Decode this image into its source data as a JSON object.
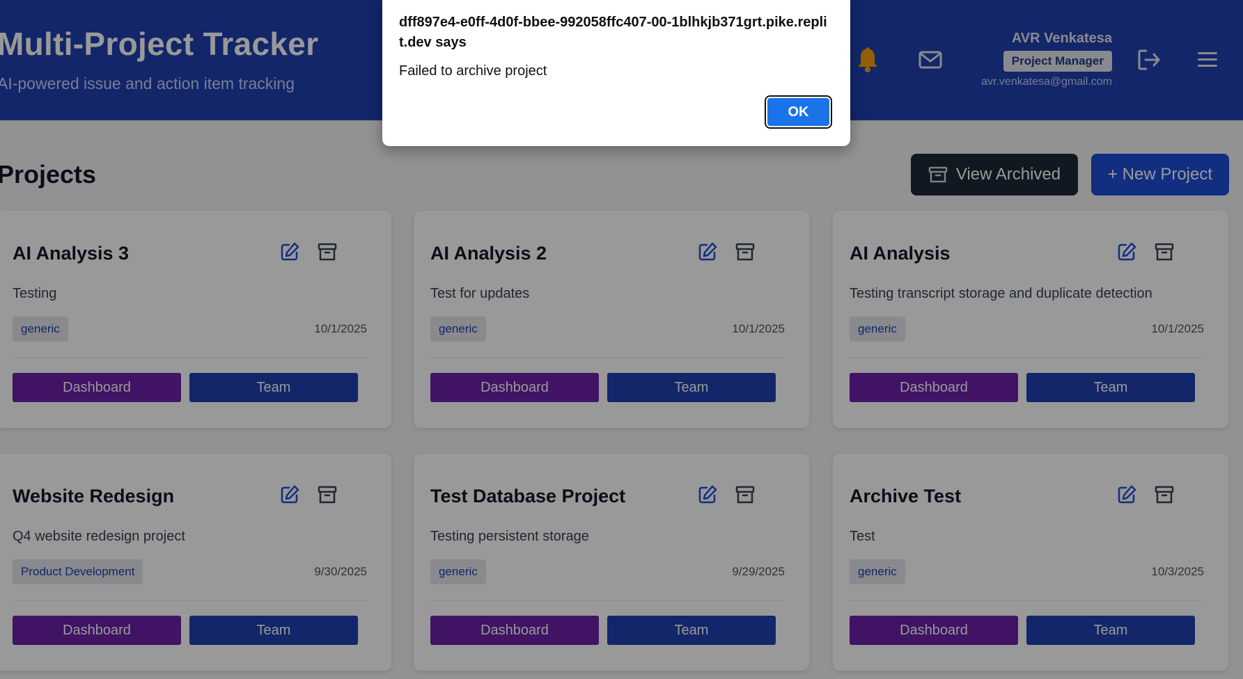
{
  "header": {
    "title": "Multi-Project Tracker",
    "subtitle": "AI-powered issue and action item tracking",
    "icons": [
      "bell-icon",
      "mail-icon",
      "logout-icon",
      "menu-icon"
    ],
    "user": {
      "name": "AVR Venkatesa",
      "role": "Project Manager",
      "email": "avr.venkatesa@gmail.com"
    }
  },
  "main": {
    "title": "Projects",
    "view_archived_label": "View Archived",
    "new_project_label": "+ New Project"
  },
  "projects": [
    {
      "name": "AI Analysis 3",
      "description": "Testing",
      "tag": "generic",
      "date": "10/1/2025",
      "dashboard_label": "Dashboard",
      "team_label": "Team"
    },
    {
      "name": "AI Analysis 2",
      "description": "Test for updates",
      "tag": "generic",
      "date": "10/1/2025",
      "dashboard_label": "Dashboard",
      "team_label": "Team"
    },
    {
      "name": "AI Analysis",
      "description": "Testing transcript storage and duplicate detection",
      "tag": "generic",
      "date": "10/1/2025",
      "dashboard_label": "Dashboard",
      "team_label": "Team"
    },
    {
      "name": "Website Redesign",
      "description": "Q4 website redesign project",
      "tag": "Product Development",
      "date": "9/30/2025",
      "dashboard_label": "Dashboard",
      "team_label": "Team"
    },
    {
      "name": "Test Database Project",
      "description": "Testing persistent storage",
      "tag": "generic",
      "date": "9/29/2025",
      "dashboard_label": "Dashboard",
      "team_label": "Team"
    },
    {
      "name": "Archive Test",
      "description": "Test",
      "tag": "generic",
      "date": "10/3/2025",
      "dashboard_label": "Dashboard",
      "team_label": "Team"
    }
  ],
  "dialog": {
    "source": "dff897e4-e0ff-4d0f-bbee-992058ffc407-00-1blhkjb371grt.pike.replit.dev says",
    "message": "Failed to archive project",
    "ok_label": "OK"
  },
  "colors": {
    "header_bg": "#1e40af",
    "dashboard_button": "#6b21a8",
    "team_button": "#1e40af",
    "ok_button": "#1a73e8"
  }
}
